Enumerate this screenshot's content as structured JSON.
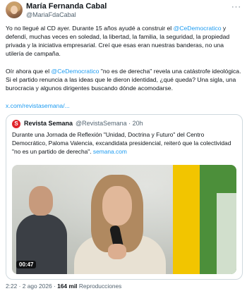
{
  "author": {
    "name": "María Fernanda Cabal",
    "handle": "@MariaFdaCabal",
    "more_label": "···"
  },
  "body": {
    "p1": [
      {
        "t": "Yo no llegué al CD ayer. Durante 15 años ayudé a construir el "
      },
      {
        "t": "@CeDemocratico",
        "m": true
      },
      {
        "t": " y defendí, muchas veces en soledad, la libertad, la familia, la seguridad, la propiedad privada y la iniciativa empresarial. Creí que esas eran nuestras banderas, no una utilería de campaña."
      }
    ],
    "p2": [
      {
        "t": "Oír ahora que el "
      },
      {
        "t": "@CeDemocratico",
        "m": true
      },
      {
        "t": " \"no es de derecha\" revela una catástrofe ideológica. Si el partido renuncia a las ideas que le dieron identidad, ¿qué queda? Una sigla, una burocracia y algunos dirigentes buscando dónde acomodarse."
      }
    ],
    "link": "x.com/revistasemana/..."
  },
  "quote": {
    "logo": "S",
    "name": "Revista Semana",
    "meta": "@RevistaSemana · 20h",
    "text": "Durante una Jornada de Reflexión \"Unidad, Doctrina y Futuro\" del Centro Democrático, Paloma Valencia, excandidata presidencial, reiteró que la colectividad \"no es un partido de derecha\". ",
    "text_link": "semana.com",
    "video_duration": "00:47"
  },
  "footer": {
    "timestamp": "2:22 · 2 ago 2026 · ",
    "views": "164 mil",
    "views_label": " Reproducciones"
  }
}
